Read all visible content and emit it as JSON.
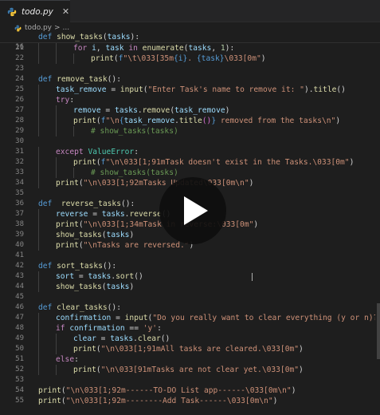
{
  "tab": {
    "title": "todo.py",
    "close_glyph": "✕"
  },
  "breadcrumb": {
    "file": "todo.py",
    "separator": ">",
    "symbol": "..."
  },
  "play": {
    "icon": "play-icon"
  },
  "colors": {
    "keyword": "#569cd6",
    "control": "#c586c0",
    "function": "#dcdcaa",
    "variable": "#9cdcfe",
    "string": "#ce9178",
    "comment": "#6a9955",
    "number": "#b5cea8",
    "type": "#4ec9b0"
  },
  "editor": {
    "sticky": {
      "num": "16",
      "tokens": [
        [
          "k",
          "def "
        ],
        [
          "f",
          "show_tasks"
        ],
        [
          "p",
          "("
        ],
        [
          "v",
          "tasks"
        ],
        [
          "p",
          "):"
        ]
      ]
    },
    "lines": [
      {
        "num": "21",
        "indent": 2,
        "tokens": [
          [
            "kc",
            "for "
          ],
          [
            "v",
            "i"
          ],
          [
            "p",
            ", "
          ],
          [
            "v",
            "task"
          ],
          [
            "kc",
            " in "
          ],
          [
            "f",
            "enumerate"
          ],
          [
            "p",
            "("
          ],
          [
            "v",
            "tasks"
          ],
          [
            "p",
            ", "
          ],
          [
            "n",
            "1"
          ],
          [
            "p",
            "):"
          ]
        ]
      },
      {
        "num": "22",
        "indent": 3,
        "tokens": [
          [
            "f",
            "print"
          ],
          [
            "p",
            "("
          ],
          [
            "k",
            "f"
          ],
          [
            "s",
            "\"\\t\\033[35m"
          ],
          [
            "k",
            "{i}"
          ],
          [
            "s",
            ". "
          ],
          [
            "k",
            "{task}"
          ],
          [
            "s",
            "\\033[0m\""
          ],
          [
            "p",
            ")"
          ]
        ]
      },
      {
        "num": "23",
        "indent": 0,
        "tokens": []
      },
      {
        "num": "24",
        "indent": 0,
        "tokens": [
          [
            "k",
            "def "
          ],
          [
            "f",
            "remove_task"
          ],
          [
            "p",
            "():"
          ]
        ]
      },
      {
        "num": "25",
        "indent": 1,
        "tokens": [
          [
            "v",
            "task_remove"
          ],
          [
            "p",
            " = "
          ],
          [
            "f",
            "input"
          ],
          [
            "p",
            "("
          ],
          [
            "s",
            "\"Enter Task's name to remove it: \""
          ],
          [
            "p",
            ")."
          ],
          [
            "f",
            "title"
          ],
          [
            "p",
            "()"
          ]
        ]
      },
      {
        "num": "26",
        "indent": 1,
        "tokens": [
          [
            "kc",
            "try"
          ],
          [
            "p",
            ":"
          ]
        ]
      },
      {
        "num": "27",
        "indent": 2,
        "tokens": [
          [
            "v",
            "remove"
          ],
          [
            "p",
            " = "
          ],
          [
            "v",
            "tasks"
          ],
          [
            "p",
            "."
          ],
          [
            "f",
            "remove"
          ],
          [
            "p",
            "("
          ],
          [
            "v",
            "task_remove"
          ],
          [
            "p",
            ")"
          ]
        ]
      },
      {
        "num": "28",
        "indent": 2,
        "tokens": [
          [
            "f",
            "print"
          ],
          [
            "p",
            "("
          ],
          [
            "k",
            "f"
          ],
          [
            "s",
            "\"\\n"
          ],
          [
            "k",
            "{"
          ],
          [
            "v",
            "task_remove"
          ],
          [
            "p",
            "."
          ],
          [
            "f",
            "title"
          ],
          [
            "br",
            "()"
          ],
          [
            "k",
            "}"
          ],
          [
            "s",
            " removed from the tasks\\n\""
          ],
          [
            "p",
            ")"
          ]
        ]
      },
      {
        "num": "29",
        "indent": 3,
        "tokens": [
          [
            "c",
            "# show_tasks(tasks)"
          ]
        ]
      },
      {
        "num": "30",
        "indent": 0,
        "tokens": []
      },
      {
        "num": "31",
        "indent": 1,
        "tokens": [
          [
            "kc",
            "except "
          ],
          [
            "t",
            "ValueError"
          ],
          [
            "p",
            ":"
          ]
        ]
      },
      {
        "num": "32",
        "indent": 2,
        "tokens": [
          [
            "f",
            "print"
          ],
          [
            "p",
            "("
          ],
          [
            "k",
            "f"
          ],
          [
            "s",
            "\"\\n\\033[1;91mTask doesn't exist in the Tasks.\\033[0m\""
          ],
          [
            "p",
            ")"
          ]
        ]
      },
      {
        "num": "33",
        "indent": 3,
        "tokens": [
          [
            "c",
            "# show_tasks(tasks)"
          ]
        ]
      },
      {
        "num": "34",
        "indent": 1,
        "tokens": [
          [
            "f",
            "print"
          ],
          [
            "p",
            "("
          ],
          [
            "s",
            "\"\\n\\033[1;92mTasks Updated\\033[0m\\n\""
          ],
          [
            "p",
            ")"
          ]
        ]
      },
      {
        "num": "35",
        "indent": 0,
        "tokens": []
      },
      {
        "num": "36",
        "indent": 0,
        "tokens": [
          [
            "k",
            "def "
          ],
          [
            "f",
            " reverse_tasks"
          ],
          [
            "p",
            "():"
          ]
        ]
      },
      {
        "num": "37",
        "indent": 1,
        "tokens": [
          [
            "v",
            "reverse"
          ],
          [
            "p",
            " = "
          ],
          [
            "v",
            "tasks"
          ],
          [
            "p",
            "."
          ],
          [
            "f",
            "reverse"
          ],
          [
            "p",
            "()"
          ]
        ]
      },
      {
        "num": "38",
        "indent": 1,
        "tokens": [
          [
            "f",
            "print"
          ],
          [
            "p",
            "("
          ],
          [
            "s",
            "\"\\n\\033[1;34mTask in reverse:\\033[0m\""
          ],
          [
            "p",
            ")"
          ]
        ]
      },
      {
        "num": "39",
        "indent": 1,
        "tokens": [
          [
            "f",
            "show_tasks"
          ],
          [
            "p",
            "("
          ],
          [
            "v",
            "tasks"
          ],
          [
            "p",
            ")"
          ]
        ]
      },
      {
        "num": "40",
        "indent": 1,
        "tokens": [
          [
            "f",
            "print"
          ],
          [
            "p",
            "("
          ],
          [
            "s",
            "\"\\nTasks are reversed.\""
          ],
          [
            "p",
            ")"
          ]
        ]
      },
      {
        "num": "41",
        "indent": 0,
        "tokens": []
      },
      {
        "num": "42",
        "indent": 0,
        "tokens": [
          [
            "k",
            "def "
          ],
          [
            "f",
            "sort_tasks"
          ],
          [
            "p",
            "():"
          ]
        ]
      },
      {
        "num": "43",
        "indent": 1,
        "tokens": [
          [
            "v",
            "sort"
          ],
          [
            "p",
            " = "
          ],
          [
            "v",
            "tasks"
          ],
          [
            "p",
            "."
          ],
          [
            "f",
            "sort"
          ],
          [
            "p",
            "()"
          ]
        ]
      },
      {
        "num": "44",
        "indent": 1,
        "tokens": [
          [
            "f",
            "show_tasks"
          ],
          [
            "p",
            "("
          ],
          [
            "v",
            "tasks"
          ],
          [
            "p",
            ")"
          ]
        ]
      },
      {
        "num": "45",
        "indent": 0,
        "tokens": []
      },
      {
        "num": "46",
        "indent": 0,
        "tokens": [
          [
            "k",
            "def "
          ],
          [
            "f",
            "clear_tasks"
          ],
          [
            "p",
            "():"
          ]
        ]
      },
      {
        "num": "47",
        "indent": 1,
        "tokens": [
          [
            "v",
            "confirmation"
          ],
          [
            "p",
            " = "
          ],
          [
            "f",
            "input"
          ],
          [
            "p",
            "("
          ],
          [
            "s",
            "\"Do you really want to clear everything (y or n)? \""
          ],
          [
            "p",
            ")."
          ],
          [
            "f",
            "lowe"
          ]
        ]
      },
      {
        "num": "48",
        "indent": 1,
        "tokens": [
          [
            "kc",
            "if "
          ],
          [
            "v",
            "confirmation"
          ],
          [
            "p",
            " == "
          ],
          [
            "s",
            "'y'"
          ],
          [
            "p",
            ":"
          ]
        ]
      },
      {
        "num": "49",
        "indent": 2,
        "tokens": [
          [
            "v",
            "clear"
          ],
          [
            "p",
            " = "
          ],
          [
            "v",
            "tasks"
          ],
          [
            "p",
            "."
          ],
          [
            "f",
            "clear"
          ],
          [
            "p",
            "()"
          ]
        ]
      },
      {
        "num": "50",
        "indent": 2,
        "tokens": [
          [
            "f",
            "print"
          ],
          [
            "p",
            "("
          ],
          [
            "s",
            "\"\\n\\033[1;91mAll tasks are cleared.\\033[0m\""
          ],
          [
            "p",
            ")"
          ]
        ]
      },
      {
        "num": "51",
        "indent": 1,
        "tokens": [
          [
            "kc",
            "else"
          ],
          [
            "p",
            ":"
          ]
        ]
      },
      {
        "num": "52",
        "indent": 2,
        "tokens": [
          [
            "f",
            "print"
          ],
          [
            "p",
            "("
          ],
          [
            "s",
            "\"\\n\\033[91mTasks are not clear yet.\\033[0m\""
          ],
          [
            "p",
            ")"
          ]
        ]
      },
      {
        "num": "53",
        "indent": 0,
        "tokens": []
      },
      {
        "num": "54",
        "indent": 0,
        "tokens": [
          [
            "f",
            "print"
          ],
          [
            "p",
            "("
          ],
          [
            "s",
            "\"\\n\\033[1;92m------TO-DO List app------\\033[0m\\n\""
          ],
          [
            "p",
            ")"
          ]
        ]
      },
      {
        "num": "55",
        "indent": 0,
        "tokens": [
          [
            "f",
            "print"
          ],
          [
            "p",
            "("
          ],
          [
            "s",
            "\"\\n\\033[1;92m--------Add Task------\\033[0m\\n\""
          ],
          [
            "p",
            ")"
          ]
        ]
      }
    ]
  }
}
